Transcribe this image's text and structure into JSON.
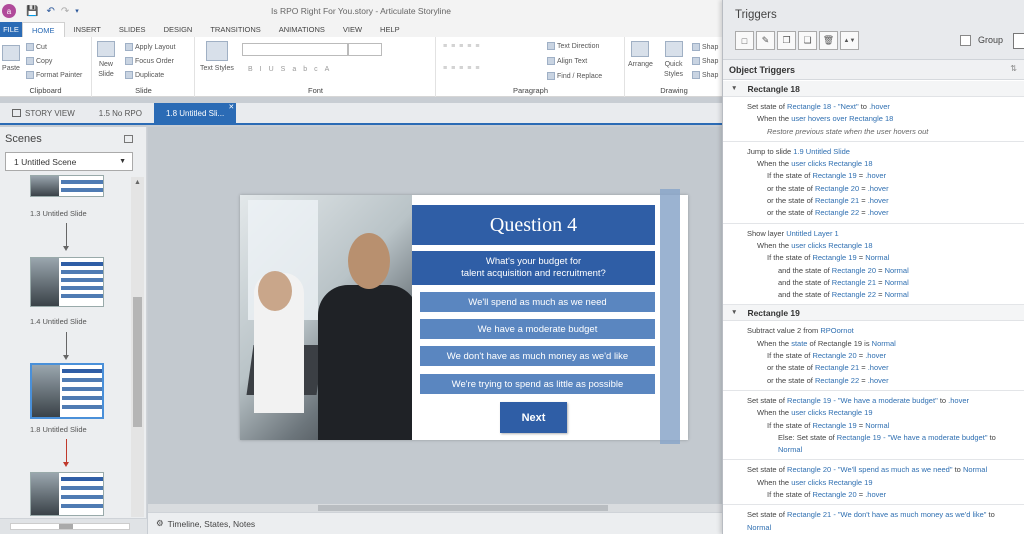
{
  "app": {
    "window_title": "Is RPO Right For You.story - Articulate Storyline",
    "logo_letter": "a"
  },
  "ribbon": {
    "file_tab": "FILE",
    "tabs": [
      "HOME",
      "INSERT",
      "SLIDES",
      "DESIGN",
      "TRANSITIONS",
      "ANIMATIONS",
      "VIEW",
      "HELP"
    ],
    "clipboard": {
      "label": "Clipboard",
      "paste": "Paste",
      "cut": "Cut",
      "copy": "Copy",
      "format_painter": "Format Painter"
    },
    "slide": {
      "label": "Slide",
      "new_slide_1": "New",
      "new_slide_2": "Slide",
      "apply_layout": "Apply Layout",
      "focus_order": "Focus Order",
      "duplicate": "Duplicate"
    },
    "font": {
      "label": "Font",
      "text_styles": "Text Styles"
    },
    "paragraph": {
      "label": "Paragraph",
      "text_direction": "Text Direction",
      "align_text": "Align Text",
      "find_replace": "Find / Replace"
    },
    "drawing": {
      "label": "Drawing",
      "arrange": "Arrange",
      "quick_styles_1": "Quick",
      "quick_styles_2": "Styles",
      "shape": "Shap"
    }
  },
  "doc_tabs": {
    "story_view": "STORY VIEW",
    "tab1": "1.5 No RPO",
    "tab2": "1.8 Untitled Sli..."
  },
  "scenes": {
    "title": "Scenes",
    "selected_scene": "1 Untitled Scene",
    "slides": [
      "1.3 Untitled Slide",
      "1.4 Untitled Slide",
      "1.8 Untitled Slide"
    ]
  },
  "slide": {
    "title": "Question 4",
    "prompt_line1": "What's your budget for",
    "prompt_line2": "talent acquisition and recruitment?",
    "options": [
      "We'll spend as much as we need",
      "We have a moderate budget",
      "We don't have as much money as we'd like",
      "We're trying to spend as little as possible"
    ],
    "next_label": "Next"
  },
  "bottom_bar": {
    "timeline_label": "Timeline, States, Notes"
  },
  "triggers": {
    "title": "Triggers",
    "group_label": "Group",
    "object_triggers_label": "Object Triggers",
    "sections": [
      {
        "name": "Rectangle 18",
        "triggers": [
          {
            "lines": [
              {
                "indent": 0,
                "parts": [
                  [
                    "",
                    "Set state of "
                  ],
                  [
                    "lk",
                    "Rectangle 18 - \"Next\""
                  ],
                  [
                    "",
                    " to "
                  ],
                  [
                    "lk",
                    ".hover"
                  ]
                ]
              },
              {
                "indent": 1,
                "parts": [
                  [
                    "",
                    "When the "
                  ],
                  [
                    "lk",
                    "user hovers over"
                  ],
                  [
                    "",
                    " "
                  ],
                  [
                    "lk",
                    "Rectangle 18"
                  ]
                ]
              },
              {
                "indent": 2,
                "parts": [
                  [
                    "i",
                    "Restore previous state when the user hovers out"
                  ]
                ]
              }
            ]
          },
          {
            "lines": [
              {
                "indent": 0,
                "parts": [
                  [
                    "",
                    "Jump to slide "
                  ],
                  [
                    "lk",
                    "1.9 Untitled Slide"
                  ]
                ]
              },
              {
                "indent": 1,
                "parts": [
                  [
                    "",
                    "When the "
                  ],
                  [
                    "lk",
                    "user clicks"
                  ],
                  [
                    "",
                    " "
                  ],
                  [
                    "lk",
                    "Rectangle 18"
                  ]
                ]
              },
              {
                "indent": 2,
                "parts": [
                  [
                    "",
                    "If the state of "
                  ],
                  [
                    "lk",
                    "Rectangle 19"
                  ],
                  [
                    "",
                    " = "
                  ],
                  [
                    "lk",
                    ".hover"
                  ]
                ]
              },
              {
                "indent": 2,
                "parts": [
                  [
                    "",
                    "or the state of "
                  ],
                  [
                    "lk",
                    "Rectangle 20"
                  ],
                  [
                    "",
                    " = "
                  ],
                  [
                    "lk",
                    ".hover"
                  ]
                ]
              },
              {
                "indent": 2,
                "parts": [
                  [
                    "",
                    "or the state of "
                  ],
                  [
                    "lk",
                    "Rectangle 21"
                  ],
                  [
                    "",
                    " = "
                  ],
                  [
                    "lk",
                    ".hover"
                  ]
                ]
              },
              {
                "indent": 2,
                "parts": [
                  [
                    "",
                    "or the state of "
                  ],
                  [
                    "lk",
                    "Rectangle 22"
                  ],
                  [
                    "",
                    " = "
                  ],
                  [
                    "lk",
                    ".hover"
                  ]
                ]
              }
            ]
          },
          {
            "lines": [
              {
                "indent": 0,
                "parts": [
                  [
                    "",
                    "Show layer "
                  ],
                  [
                    "lk",
                    "Untitled Layer 1"
                  ]
                ]
              },
              {
                "indent": 1,
                "parts": [
                  [
                    "",
                    "When the "
                  ],
                  [
                    "lk",
                    "user clicks"
                  ],
                  [
                    "",
                    " "
                  ],
                  [
                    "lk",
                    "Rectangle 18"
                  ]
                ]
              },
              {
                "indent": 2,
                "parts": [
                  [
                    "",
                    "If the state of "
                  ],
                  [
                    "lk",
                    "Rectangle 19"
                  ],
                  [
                    "",
                    " = "
                  ],
                  [
                    "lk",
                    "Normal"
                  ]
                ]
              },
              {
                "indent": 3,
                "parts": [
                  [
                    "",
                    "and the state of "
                  ],
                  [
                    "lk",
                    "Rectangle 20"
                  ],
                  [
                    "",
                    " = "
                  ],
                  [
                    "lk",
                    "Normal"
                  ]
                ]
              },
              {
                "indent": 3,
                "parts": [
                  [
                    "",
                    "and the state of "
                  ],
                  [
                    "lk",
                    "Rectangle 21"
                  ],
                  [
                    "",
                    " = "
                  ],
                  [
                    "lk",
                    "Normal"
                  ]
                ]
              },
              {
                "indent": 3,
                "parts": [
                  [
                    "",
                    "and the state of "
                  ],
                  [
                    "lk",
                    "Rectangle 22"
                  ],
                  [
                    "",
                    " = "
                  ],
                  [
                    "lk",
                    "Normal"
                  ]
                ]
              }
            ]
          }
        ]
      },
      {
        "name": "Rectangle 19",
        "triggers": [
          {
            "lines": [
              {
                "indent": 0,
                "parts": [
                  [
                    "",
                    "Subtract value "
                  ],
                  [
                    "",
                    "2"
                  ],
                  [
                    "",
                    " from "
                  ],
                  [
                    "lk",
                    "RPOornot"
                  ]
                ]
              },
              {
                "indent": 1,
                "parts": [
                  [
                    "",
                    "When the "
                  ],
                  [
                    "lk",
                    "state"
                  ],
                  [
                    "",
                    " of Rectangle 19 is "
                  ],
                  [
                    "lk",
                    "Normal"
                  ]
                ]
              },
              {
                "indent": 2,
                "parts": [
                  [
                    "",
                    "If the state of "
                  ],
                  [
                    "lk",
                    "Rectangle 20"
                  ],
                  [
                    "",
                    " = "
                  ],
                  [
                    "lk",
                    ".hover"
                  ]
                ]
              },
              {
                "indent": 2,
                "parts": [
                  [
                    "",
                    "or the state of "
                  ],
                  [
                    "lk",
                    "Rectangle 21"
                  ],
                  [
                    "",
                    " = "
                  ],
                  [
                    "lk",
                    ".hover"
                  ]
                ]
              },
              {
                "indent": 2,
                "parts": [
                  [
                    "",
                    "or the state of "
                  ],
                  [
                    "lk",
                    "Rectangle 22"
                  ],
                  [
                    "",
                    " = "
                  ],
                  [
                    "lk",
                    ".hover"
                  ]
                ]
              }
            ]
          },
          {
            "lines": [
              {
                "indent": 0,
                "parts": [
                  [
                    "",
                    "Set state of "
                  ],
                  [
                    "lk",
                    "Rectangle 19 - \"We have a moderate budget\""
                  ],
                  [
                    "",
                    " to "
                  ],
                  [
                    "lk",
                    ".hover"
                  ]
                ]
              },
              {
                "indent": 1,
                "parts": [
                  [
                    "",
                    "When the "
                  ],
                  [
                    "lk",
                    "user clicks"
                  ],
                  [
                    "",
                    " "
                  ],
                  [
                    "lk",
                    "Rectangle 19"
                  ]
                ]
              },
              {
                "indent": 2,
                "parts": [
                  [
                    "",
                    "If the state of "
                  ],
                  [
                    "lk",
                    "Rectangle 19"
                  ],
                  [
                    "",
                    " = "
                  ],
                  [
                    "lk",
                    "Normal"
                  ]
                ]
              },
              {
                "indent": 3,
                "parts": [
                  [
                    "",
                    "Else: Set state of "
                  ],
                  [
                    "lk",
                    "Rectangle 19 - \"We have a moderate budget\""
                  ],
                  [
                    "",
                    " to"
                  ]
                ]
              },
              {
                "indent": 3,
                "parts": [
                  [
                    "lk",
                    "Normal"
                  ]
                ]
              }
            ]
          },
          {
            "lines": [
              {
                "indent": 0,
                "parts": [
                  [
                    "",
                    "Set state of "
                  ],
                  [
                    "lk",
                    "Rectangle 20 - \"We'll spend as much as we need\""
                  ],
                  [
                    "",
                    " to "
                  ],
                  [
                    "lk",
                    "Normal"
                  ]
                ]
              },
              {
                "indent": 1,
                "parts": [
                  [
                    "",
                    "When the "
                  ],
                  [
                    "lk",
                    "user clicks"
                  ],
                  [
                    "",
                    " "
                  ],
                  [
                    "lk",
                    "Rectangle 19"
                  ]
                ]
              },
              {
                "indent": 2,
                "parts": [
                  [
                    "",
                    "If the state of "
                  ],
                  [
                    "lk",
                    "Rectangle 20"
                  ],
                  [
                    "",
                    " = "
                  ],
                  [
                    "lk",
                    ".hover"
                  ]
                ]
              }
            ]
          },
          {
            "lines": [
              {
                "indent": 0,
                "parts": [
                  [
                    "",
                    "Set state of "
                  ],
                  [
                    "lk",
                    "Rectangle 21 - \"We don't have as much money as we'd like\""
                  ],
                  [
                    "",
                    " to"
                  ]
                ]
              },
              {
                "indent": 0,
                "parts": [
                  [
                    "lk",
                    "Normal"
                  ]
                ]
              }
            ]
          }
        ]
      }
    ]
  }
}
